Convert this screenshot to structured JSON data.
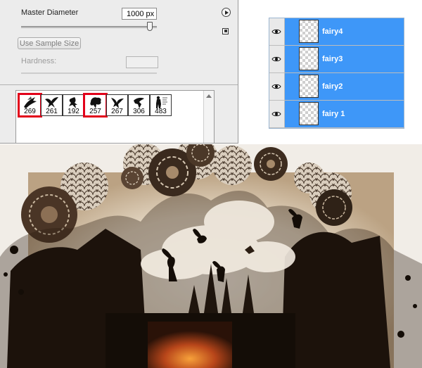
{
  "brush_panel": {
    "master_diameter_label": "Master Diameter",
    "master_diameter_value": "1000 px",
    "use_sample_size_label": "Use Sample Size",
    "hardness_label": "Hardness:",
    "presets": [
      {
        "value": "269",
        "selected": true
      },
      {
        "value": "261",
        "selected": false
      },
      {
        "value": "192",
        "selected": false
      },
      {
        "value": "257",
        "selected": true
      },
      {
        "value": "267",
        "selected": false
      },
      {
        "value": "306",
        "selected": false
      },
      {
        "value": "483",
        "selected": false
      }
    ]
  },
  "layers_panel": {
    "layers": [
      {
        "name": "fairy4",
        "visible": true
      },
      {
        "name": "fairy3",
        "visible": true
      },
      {
        "name": "fairy2",
        "visible": true
      },
      {
        "name": "fairy 1",
        "visible": true
      }
    ],
    "selection_color": "#3e97f8"
  },
  "artwork": {
    "icons": [
      "flower-icon",
      "fairy-silhouette-icon",
      "tree-icon"
    ],
    "palette": [
      "#1a110a",
      "#5c4330",
      "#9b7f61",
      "#efe6d8",
      "#d8641d"
    ]
  }
}
